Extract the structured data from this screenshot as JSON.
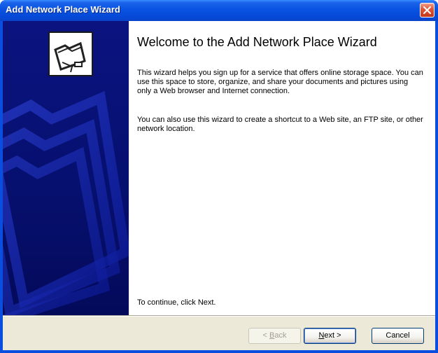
{
  "window": {
    "title": "Add Network Place Wizard"
  },
  "content": {
    "heading": "Welcome to the Add Network Place Wizard",
    "paragraph1": "This wizard helps you sign up for a service that offers online storage space. You can use this space to store, organize, and share your documents and pictures using only a Web browser and Internet connection.",
    "paragraph2": "You can also use this wizard to create a shortcut to a Web site, an FTP site, or other network location.",
    "continue_text": "To continue, click Next."
  },
  "buttons": {
    "back_underlined": "B",
    "back_rest": "ack",
    "back_prefix": "< ",
    "next_underlined": "N",
    "next_rest": "ext >",
    "cancel": "Cancel"
  },
  "colors": {
    "titlebar": "#0a53e2",
    "sidebar": "#06106f",
    "dialog_face": "#ece9d8"
  }
}
